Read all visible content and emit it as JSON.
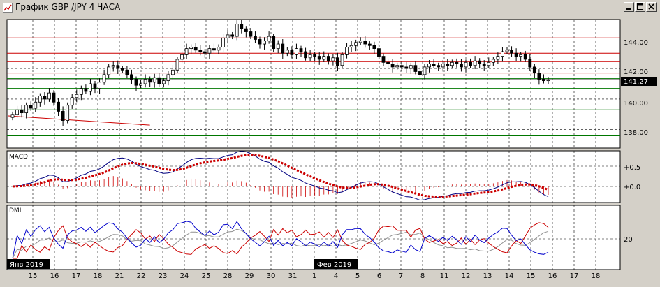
{
  "window": {
    "title": "График GBP /JPY  4 ЧАСА",
    "minimize_label": "_",
    "maximize_label": "□",
    "close_label": "X"
  },
  "price_panel": {
    "last_price": "141.27",
    "y_labels": [
      "144.00",
      "142.00",
      "140.00",
      "138.00"
    ]
  },
  "macd_panel": {
    "title": "MACD",
    "y_labels": [
      "+0.5",
      "+0.0"
    ]
  },
  "dmi_panel": {
    "title": "DMI",
    "y_labels": [
      "20"
    ]
  },
  "x_axis": {
    "month_labels": [
      "Янв 2019",
      "Фев 2019"
    ],
    "day_labels": [
      "15",
      "16",
      "17",
      "18",
      "21",
      "22",
      "23",
      "24",
      "25",
      "28",
      "29",
      "30",
      "31",
      "1",
      "4",
      "5",
      "6",
      "7",
      "8",
      "11",
      "12",
      "13",
      "14",
      "15",
      "16",
      "17",
      "18"
    ]
  },
  "colors": {
    "background": "#ffffff",
    "grid": "#000000",
    "resistance_line": "#cc0000",
    "support_line": "#007700",
    "macd_signal": "#cc0000",
    "macd_line": "#000080",
    "dmi_plus": "#0000cc",
    "dmi_minus": "#cc0000",
    "adx": "#909090"
  },
  "chart_data": [
    {
      "type": "candlestick",
      "pair": "GBP/JPY",
      "timeframe": "4 hours",
      "ylim": [
        136.8,
        145.2
      ],
      "last_price": 141.27,
      "horizontal_levels_red": [
        144.0,
        143.0,
        142.45,
        141.7
      ],
      "horizontal_levels_green": [
        141.35,
        140.7,
        139.3,
        137.6
      ],
      "trendline": {
        "from": [
          0,
          138.9
        ],
        "to": [
          30,
          138.3
        ]
      },
      "closes": [
        139.0,
        139.3,
        139.1,
        139.6,
        139.4,
        139.8,
        140.2,
        140.0,
        140.4,
        139.8,
        139.2,
        138.6,
        139.6,
        140.1,
        140.3,
        140.7,
        140.5,
        141.0,
        140.7,
        141.1,
        141.6,
        142.1,
        142.2,
        142.0,
        141.9,
        141.6,
        141.3,
        140.9,
        141.0,
        141.3,
        141.1,
        141.4,
        141.0,
        141.2,
        141.6,
        141.9,
        142.6,
        142.9,
        143.3,
        143.4,
        143.2,
        143.1,
        143.0,
        143.3,
        143.2,
        143.4,
        144.0,
        144.2,
        144.1,
        144.9,
        144.6,
        144.4,
        144.1,
        143.9,
        143.6,
        143.8,
        144.1,
        143.3,
        143.6,
        143.0,
        143.2,
        142.9,
        143.3,
        143.1,
        142.7,
        142.9,
        142.8,
        142.6,
        142.8,
        142.5,
        142.7,
        142.2,
        142.9,
        143.4,
        143.5,
        143.7,
        143.8,
        143.6,
        143.5,
        143.3,
        142.8,
        142.4,
        142.3,
        142.1,
        142.2,
        142.1,
        142.0,
        142.2,
        141.8,
        141.6,
        142.1,
        142.3,
        142.2,
        142.1,
        142.3,
        142.2,
        142.4,
        142.3,
        142.1,
        142.4,
        142.2,
        142.5,
        142.3,
        142.2,
        142.4,
        142.6,
        142.8,
        143.1,
        143.2,
        143.0,
        142.8,
        142.9,
        142.6,
        142.1,
        141.7,
        141.3,
        141.2,
        141.27
      ]
    },
    {
      "type": "line",
      "name": "MACD",
      "ylim": [
        -0.45,
        0.95
      ]
    },
    {
      "type": "line",
      "name": "DMI",
      "reference_level": 20
    }
  ]
}
